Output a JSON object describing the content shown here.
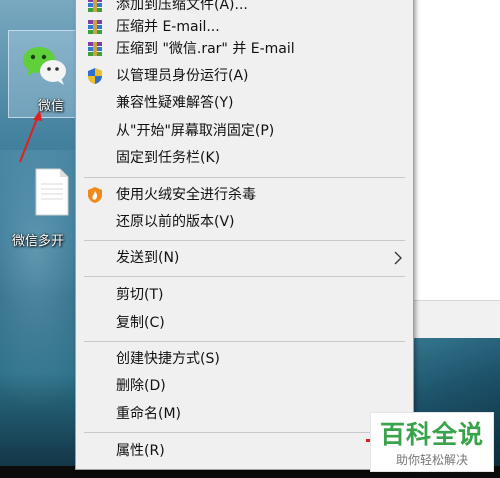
{
  "desktop": {
    "icons": [
      {
        "label": "微信",
        "icon": "wechat-icon"
      },
      {
        "label": "微信多开",
        "icon": "document-icon"
      }
    ]
  },
  "context_menu": {
    "items": [
      {
        "label": "添加到压缩文件(A)...",
        "icon": "winrar-icon"
      },
      {
        "label": "压缩并 E-mail...",
        "icon": "winrar-icon"
      },
      {
        "label": "压缩到 \"微信.rar\" 并 E-mail",
        "icon": "winrar-icon"
      },
      {
        "label": "以管理员身份运行(A)",
        "icon": "uac-shield-icon"
      },
      {
        "label": "兼容性疑难解答(Y)"
      },
      {
        "label": "从\"开始\"屏幕取消固定(P)"
      },
      {
        "label": "固定到任务栏(K)"
      },
      {
        "label": "使用火绒安全进行杀毒",
        "icon": "huorong-icon"
      },
      {
        "label": "还原以前的版本(V)"
      },
      {
        "label": "发送到(N)",
        "submenu": true
      },
      {
        "label": "剪切(T)"
      },
      {
        "label": "复制(C)"
      },
      {
        "label": "创建快捷方式(S)"
      },
      {
        "label": "删除(D)"
      },
      {
        "label": "重命名(M)"
      },
      {
        "label": "属性(R)"
      }
    ]
  },
  "watermark": {
    "title": "百科全说",
    "subtitle": "助你轻松解决"
  },
  "colors": {
    "menu_bg": "#f0f0f0",
    "watermark_green": "#39a34c",
    "arrow_red": "#e02020"
  }
}
